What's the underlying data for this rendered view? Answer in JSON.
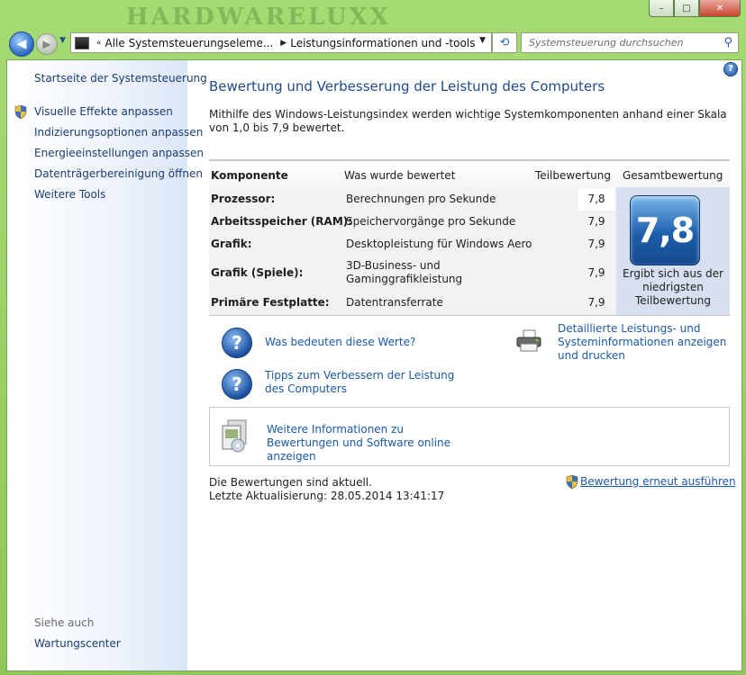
{
  "window": {
    "watermark": "HARDWARELUXX",
    "minimize_glyph": "–",
    "maximize_glyph": "□",
    "close_glyph": "✕"
  },
  "nav": {
    "back_glyph": "◀",
    "forward_glyph": "▶",
    "breadcrumb": [
      "Alle Systemsteuerungseleme...",
      "Leistungsinformationen und -tools"
    ],
    "search_placeholder": "Systemsteuerung durchsuchen"
  },
  "sidebar": {
    "home": "Startseite der Systemsteuerung",
    "items": [
      {
        "label": "Visuelle Effekte anpassen",
        "shield": true
      },
      {
        "label": "Indizierungsoptionen anpassen",
        "shield": false
      },
      {
        "label": "Energieeinstellungen anpassen",
        "shield": false
      },
      {
        "label": "Datenträgerbereinigung öffnen",
        "shield": false
      },
      {
        "label": "Weitere Tools",
        "shield": false
      }
    ],
    "see_also_title": "Siehe auch",
    "see_also": [
      "Wartungscenter"
    ]
  },
  "main": {
    "title": "Bewertung und Verbesserung der Leistung des Computers",
    "intro": "Mithilfe des Windows-Leistungsindex werden wichtige Systemkomponenten anhand einer Skala von 1,0 bis 7,9 bewertet.",
    "table": {
      "headers": {
        "component": "Komponente",
        "what": "Was wurde bewertet",
        "subscore": "Teilbewertung",
        "total": "Gesamtbewertung"
      },
      "rows": [
        {
          "component": "Prozessor:",
          "what": "Berechnungen pro Sekunde",
          "score": "7,8"
        },
        {
          "component": "Arbeitsspeicher (RAM):",
          "what": "Speichervorgänge pro Sekunde",
          "score": "7,9"
        },
        {
          "component": "Grafik:",
          "what": "Desktopleistung für Windows Aero",
          "score": "7,9"
        },
        {
          "component": "Grafik (Spiele):",
          "what": "3D-Business- und Gaminggrafikleistung",
          "score": "7,9"
        },
        {
          "component": "Primäre Festplatte:",
          "what": "Datentransferrate",
          "score": "7,9"
        }
      ],
      "total_score": "7,8",
      "total_note": "Ergibt sich aus der niedrigsten Teilbewertung"
    },
    "links": {
      "meaning": "Was bedeuten diese Werte?",
      "tips": "Tipps zum Verbessern der Leistung des Computers",
      "details": "Detaillierte Leistungs- und Systeminformationen anzeigen und drucken",
      "online": "Weitere Informationen zu Bewertungen und Software online anzeigen"
    },
    "status": {
      "current": "Die Bewertungen sind aktuell.",
      "last_update": "Letzte Aktualisierung: 28.05.2014 13:41:17",
      "rerun": "Bewertung erneut ausführen"
    }
  }
}
